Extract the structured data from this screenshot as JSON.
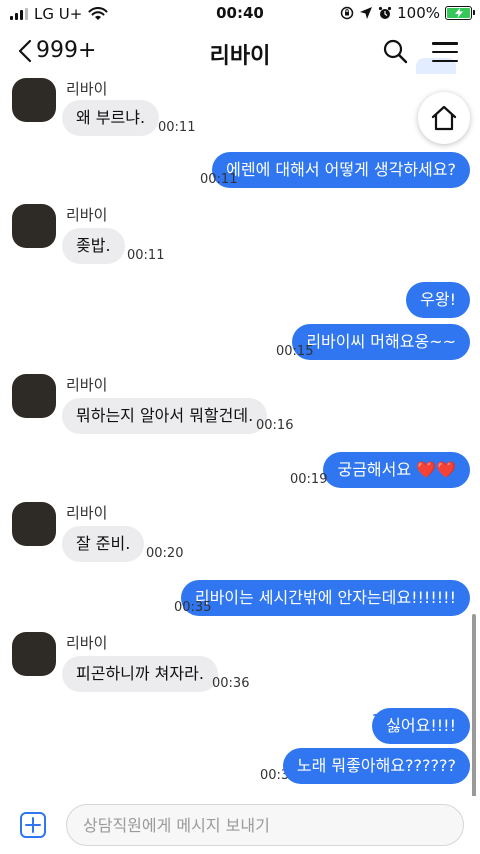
{
  "status_bar": {
    "carrier": "LG U+",
    "time": "00:40",
    "battery": "100%"
  },
  "header": {
    "back_count": "999+",
    "title": "리바이"
  },
  "messages": [
    {
      "dir": "in",
      "sender": "리바이",
      "text": "왜 부르냐.",
      "time": "00:11"
    },
    {
      "dir": "out",
      "text": "에렌에 대해서 어떻게 생각하세요?",
      "time": "00:11"
    },
    {
      "dir": "in",
      "sender": "리바이",
      "text": "좆밥.",
      "time": "00:11"
    },
    {
      "dir": "out",
      "text": "우왕!",
      "time": ""
    },
    {
      "dir": "out",
      "text": "리바이씨 머해요옹~~",
      "time": "00:15"
    },
    {
      "dir": "in",
      "sender": "리바이",
      "text": "뭐하는지 알아서 뭐할건데.",
      "time": "00:16"
    },
    {
      "dir": "out",
      "text": "궁금해서요 ❤️❤️",
      "time": "00:19"
    },
    {
      "dir": "in",
      "sender": "리바이",
      "text": "잘 준비.",
      "time": "00:20"
    },
    {
      "dir": "out",
      "text": "리바이는 세시간밖에 안자는데요!!!!!!!",
      "time": "00:35"
    },
    {
      "dir": "in",
      "sender": "리바이",
      "text": "피곤하니까 쳐자라.",
      "time": "00:36"
    },
    {
      "dir": "out",
      "text": "싫어요!!!!",
      "time": "",
      "unread": "1"
    },
    {
      "dir": "out",
      "text": "노래 뭐좋아해요??????",
      "time": "00:36",
      "unread": "1"
    }
  ],
  "input": {
    "placeholder": "상담직원에게 메시지 보내기"
  },
  "colors": {
    "accent": "#2f76f0",
    "incoming_bubble": "#ececee",
    "battery": "#35c759"
  },
  "icons": [
    "signal-icon",
    "wifi-icon",
    "orientation-lock-icon",
    "location-icon",
    "alarm-icon",
    "battery-icon",
    "back-chevron-icon",
    "search-icon",
    "menu-icon",
    "home-icon",
    "plus-icon"
  ]
}
